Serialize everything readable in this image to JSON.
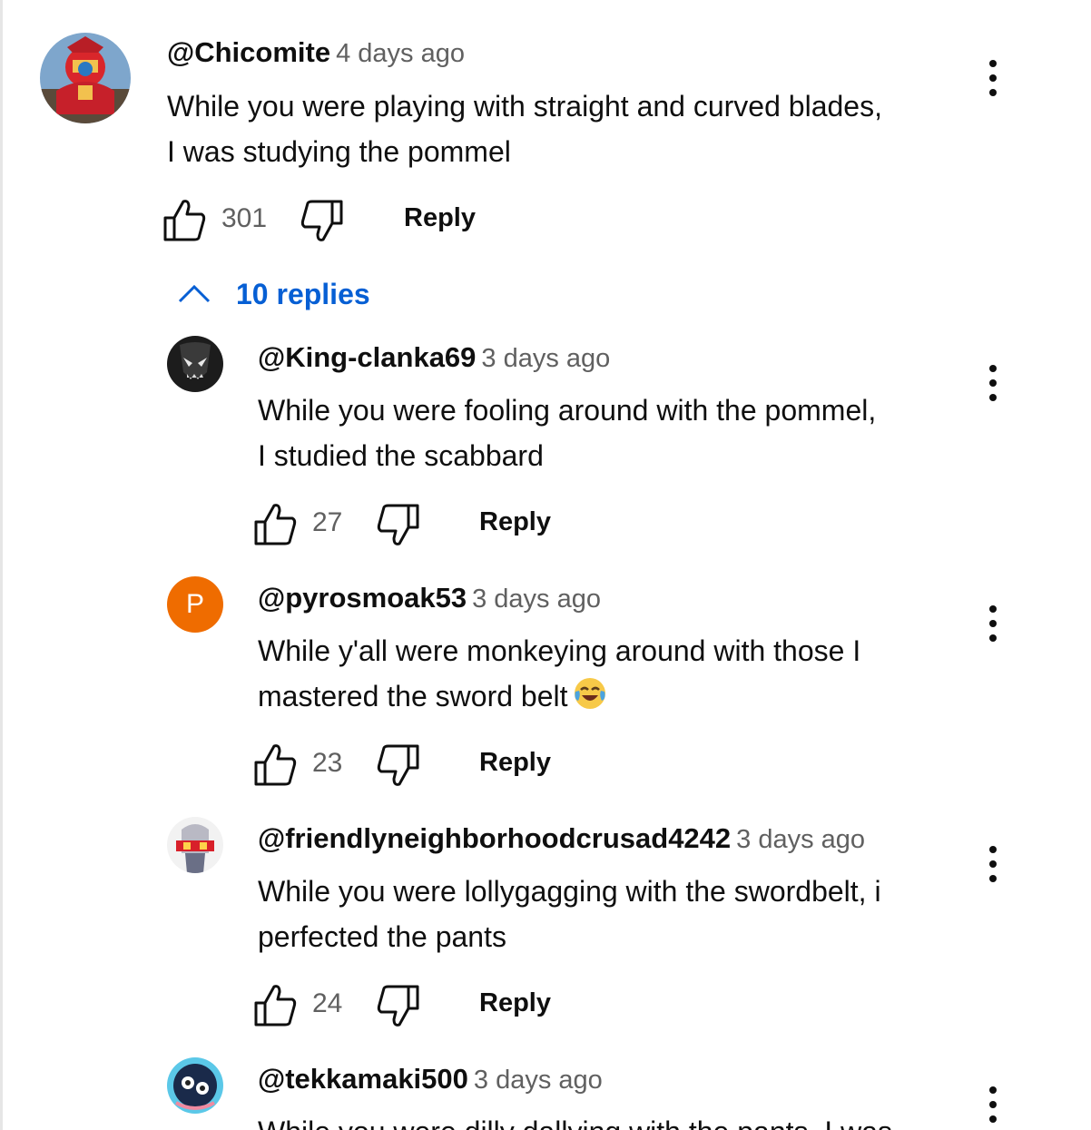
{
  "top_comment": {
    "author": "@Chicomite",
    "time": "4 days ago",
    "text_line1": "While you were playing with straight and curved blades,",
    "text_line2": "I was studying the pommel",
    "likes": "301",
    "reply_label": "Reply",
    "replies_toggle": "10 replies"
  },
  "replies": [
    {
      "author": "@King-clanka69",
      "time": "3 days ago",
      "text_line1": "While you were fooling around with the pommel,",
      "text_line2": "I studied the scabbard",
      "likes": "27",
      "reply_label": "Reply"
    },
    {
      "author": "@pyrosmoak53",
      "avatar_initial": "P",
      "time": "3 days ago",
      "text_line1": "While y'all were monkeying around with those I",
      "text_line2": "mastered the sword belt",
      "likes": "23",
      "reply_label": "Reply"
    },
    {
      "author": "@friendlyneighborhoodcrusad4242",
      "time": "3 days ago",
      "text_line1": "While you were lollygagging with the swordbelt, i",
      "text_line2": "perfected the pants",
      "likes": "24",
      "reply_label": "Reply"
    },
    {
      "author": "@tekkamaki500",
      "time": "3 days ago",
      "text_line1": "While you were dilly dallying with the pants, I was"
    }
  ],
  "icons": {
    "like": "thumbs-up-icon",
    "dislike": "thumbs-down-icon",
    "menu": "more-vert-icon",
    "chevron": "chevron-up-icon",
    "emoji": "face-with-tears-of-joy-emoji"
  },
  "colors": {
    "link_blue": "#065fd4",
    "initial_avatar": "#ef6c00",
    "secondary_text": "#606060"
  }
}
